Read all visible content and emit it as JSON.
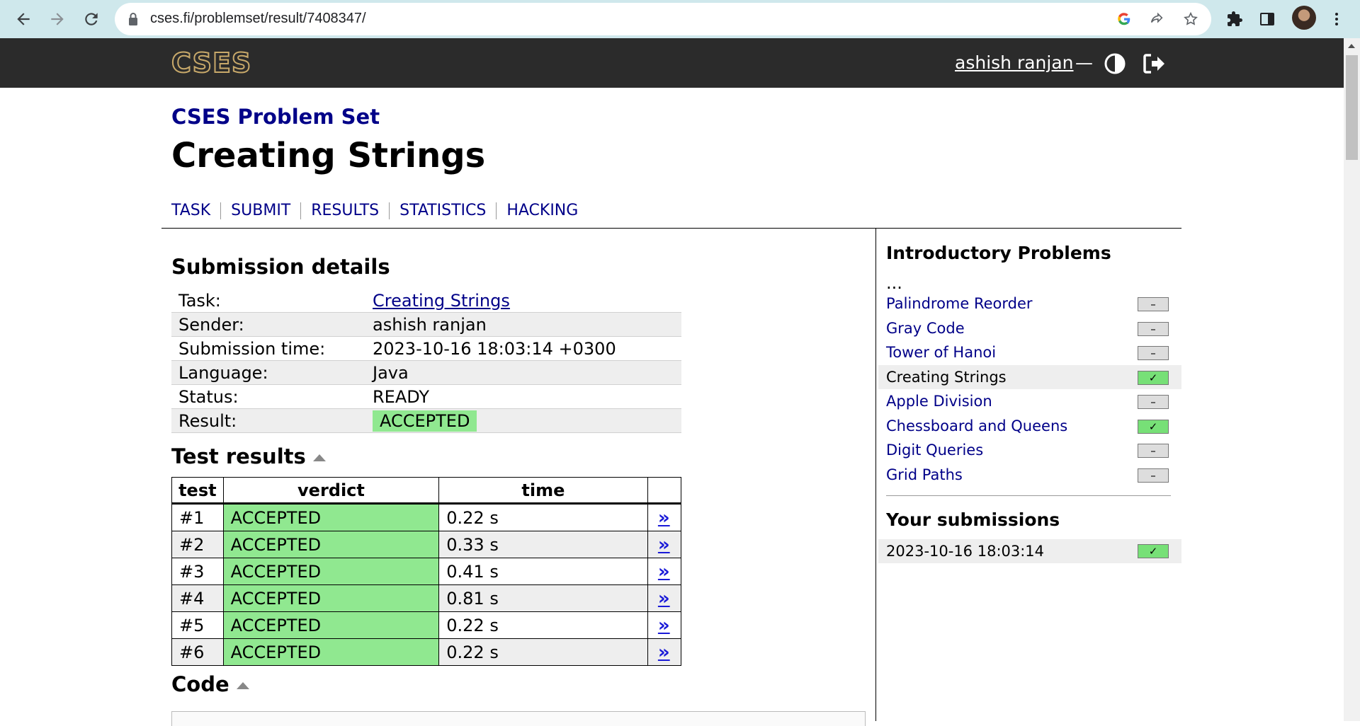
{
  "browser": {
    "url": "cses.fi/problemset/result/7408347/"
  },
  "header": {
    "logo": "CSES",
    "user_name": "ashish ranjan",
    "separator": "—"
  },
  "page": {
    "set_title": "CSES Problem Set",
    "title": "Creating Strings",
    "tabs": [
      "TASK",
      "SUBMIT",
      "RESULTS",
      "STATISTICS",
      "HACKING"
    ]
  },
  "details": {
    "heading": "Submission details",
    "rows": [
      {
        "label": "Task:",
        "value": "Creating Strings"
      },
      {
        "label": "Sender:",
        "value": "ashish ranjan"
      },
      {
        "label": "Submission time:",
        "value": "2023-10-16 18:03:14 +0300"
      },
      {
        "label": "Language:",
        "value": "Java"
      },
      {
        "label": "Status:",
        "value": "READY"
      },
      {
        "label": "Result:",
        "value": "ACCEPTED"
      }
    ]
  },
  "tests": {
    "heading": "Test results",
    "columns": [
      "test",
      "verdict",
      "time",
      ""
    ],
    "rows": [
      {
        "test": "#1",
        "verdict": "ACCEPTED",
        "time": "0.22 s",
        "link": "»"
      },
      {
        "test": "#2",
        "verdict": "ACCEPTED",
        "time": "0.33 s",
        "link": "»"
      },
      {
        "test": "#3",
        "verdict": "ACCEPTED",
        "time": "0.41 s",
        "link": "»"
      },
      {
        "test": "#4",
        "verdict": "ACCEPTED",
        "time": "0.81 s",
        "link": "»"
      },
      {
        "test": "#5",
        "verdict": "ACCEPTED",
        "time": "0.22 s",
        "link": "»"
      },
      {
        "test": "#6",
        "verdict": "ACCEPTED",
        "time": "0.22 s",
        "link": "»"
      }
    ]
  },
  "code": {
    "heading": "Code"
  },
  "sidebar": {
    "title": "Introductory Problems",
    "ellipsis": "...",
    "items": [
      {
        "name": "Palindrome Reorder",
        "status": "–",
        "solved": false,
        "current": false
      },
      {
        "name": "Gray Code",
        "status": "–",
        "solved": false,
        "current": false
      },
      {
        "name": "Tower of Hanoi",
        "status": "–",
        "solved": false,
        "current": false
      },
      {
        "name": "Creating Strings",
        "status": "✓",
        "solved": true,
        "current": true
      },
      {
        "name": "Apple Division",
        "status": "–",
        "solved": false,
        "current": false
      },
      {
        "name": "Chessboard and Queens",
        "status": "✓",
        "solved": true,
        "current": false
      },
      {
        "name": "Digit Queries",
        "status": "–",
        "solved": false,
        "current": false
      },
      {
        "name": "Grid Paths",
        "status": "–",
        "solved": false,
        "current": false
      }
    ],
    "submissions_title": "Your submissions",
    "submissions": [
      {
        "time": "2023-10-16 18:03:14",
        "status": "✓",
        "solved": true
      }
    ]
  },
  "colors": {
    "accent": "#000088",
    "accepted": "#90e890",
    "header_bg": "#2b2b2b"
  }
}
